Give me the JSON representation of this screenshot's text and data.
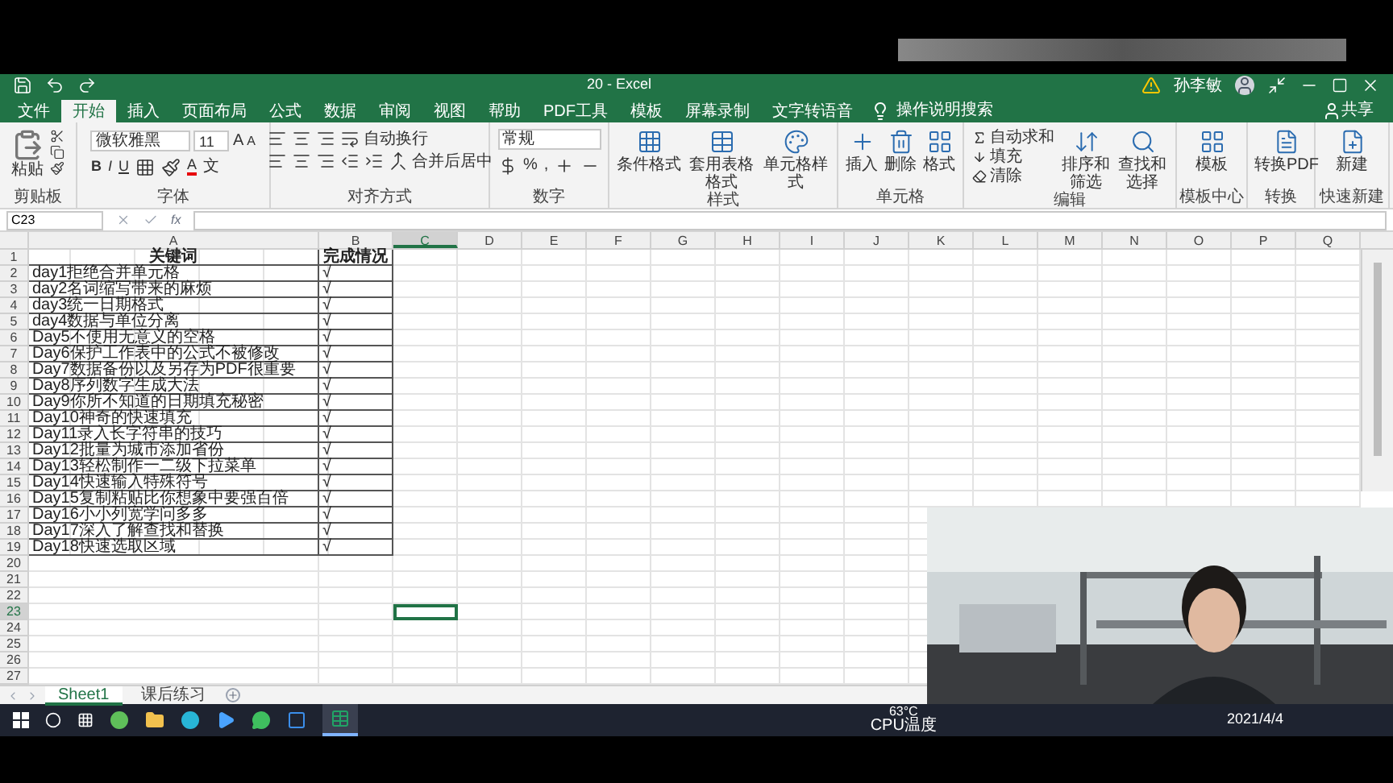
{
  "title_bar": {
    "title": "20 - Excel",
    "user": "孙李敏"
  },
  "tabs": [
    {
      "label": "文件",
      "selected": false
    },
    {
      "label": "开始",
      "selected": true
    },
    {
      "label": "插入",
      "selected": false
    },
    {
      "label": "页面布局",
      "selected": false
    },
    {
      "label": "公式",
      "selected": false
    },
    {
      "label": "数据",
      "selected": false
    },
    {
      "label": "审阅",
      "selected": false
    },
    {
      "label": "视图",
      "selected": false
    },
    {
      "label": "帮助",
      "selected": false
    },
    {
      "label": "PDF工具",
      "selected": false
    },
    {
      "label": "模板",
      "selected": false
    },
    {
      "label": "屏幕录制",
      "selected": false
    },
    {
      "label": "文字转语音",
      "selected": false
    }
  ],
  "tell_me": "操作说明搜索",
  "share": "共享",
  "ribbon": {
    "clipboard": {
      "paste": "粘贴",
      "label": "剪贴板"
    },
    "font": {
      "name": "微软雅黑",
      "size": "11",
      "grow": "A",
      "shrink": "A",
      "bold": "B",
      "italic": "I",
      "underline": "U",
      "font_color_letter": "A",
      "phonetic": "文",
      "label": "字体"
    },
    "alignment": {
      "wrap": "自动换行",
      "merge": "合并后居中",
      "label": "对齐方式"
    },
    "number": {
      "format": "常规",
      "percent": "%",
      "comma": ",",
      "label": "数字"
    },
    "styles": {
      "buttons": [
        "条件格式",
        "套用表格格式",
        "单元格样式"
      ],
      "label": "样式"
    },
    "cells": {
      "buttons": [
        "插入",
        "删除",
        "格式"
      ],
      "label": "单元格"
    },
    "editing": {
      "small": [
        "自动求和",
        "填充",
        "清除"
      ],
      "buttons": [
        "排序和筛选",
        "查找和选择"
      ],
      "label": "编辑"
    },
    "template": {
      "buttons": [
        "模板"
      ],
      "label": "模板中心"
    },
    "convert": {
      "buttons": [
        "转换PDF"
      ],
      "label": "转换"
    },
    "quick_new": {
      "buttons": [
        "新建"
      ],
      "label": "快速新建"
    }
  },
  "formula_bar": {
    "name_box": "C23",
    "fx": "fx"
  },
  "columns": [
    {
      "label": "A",
      "selected": false
    },
    {
      "label": "B",
      "selected": false
    },
    {
      "label": "C",
      "selected": true
    },
    {
      "label": "D",
      "selected": false
    },
    {
      "label": "E",
      "selected": false
    },
    {
      "label": "F",
      "selected": false
    },
    {
      "label": "G",
      "selected": false
    },
    {
      "label": "H",
      "selected": false
    },
    {
      "label": "I",
      "selected": false
    },
    {
      "label": "J",
      "selected": false
    },
    {
      "label": "K",
      "selected": false
    },
    {
      "label": "L",
      "selected": false
    },
    {
      "label": "M",
      "selected": false
    },
    {
      "label": "N",
      "selected": false
    },
    {
      "label": "O",
      "selected": false
    },
    {
      "label": "P",
      "selected": false
    },
    {
      "label": "Q",
      "selected": false
    }
  ],
  "rows": [
    {
      "number": "1",
      "selected": false,
      "cells": [
        "关键词",
        "完成情况"
      ]
    },
    {
      "number": "2",
      "selected": false,
      "cells": [
        "day1拒绝合并单元格",
        "√"
      ]
    },
    {
      "number": "3",
      "selected": false,
      "cells": [
        "day2名词缩写带来的麻烦",
        "√"
      ]
    },
    {
      "number": "4",
      "selected": false,
      "cells": [
        "day3统一日期格式",
        "√"
      ]
    },
    {
      "number": "5",
      "selected": false,
      "cells": [
        "day4数据与单位分离",
        "√"
      ]
    },
    {
      "number": "6",
      "selected": false,
      "cells": [
        "Day5不使用无意义的空格",
        "√"
      ]
    },
    {
      "number": "7",
      "selected": false,
      "cells": [
        "Day6保护工作表中的公式不被修改",
        "√"
      ]
    },
    {
      "number": "8",
      "selected": false,
      "cells": [
        "Day7数据备份以及另存为PDF很重要",
        "√"
      ]
    },
    {
      "number": "9",
      "selected": false,
      "cells": [
        "Day8序列数字生成大法",
        "√"
      ]
    },
    {
      "number": "10",
      "selected": false,
      "cells": [
        "Day9你所不知道的日期填充秘密",
        "√"
      ]
    },
    {
      "number": "11",
      "selected": false,
      "cells": [
        "Day10神奇的快速填充",
        "√"
      ]
    },
    {
      "number": "12",
      "selected": false,
      "cells": [
        "Day11录入长字符串的技巧",
        "√"
      ]
    },
    {
      "number": "13",
      "selected": false,
      "cells": [
        "Day12批量为城市添加省份",
        "√"
      ]
    },
    {
      "number": "14",
      "selected": false,
      "cells": [
        "Day13轻松制作一二级下拉菜单",
        "√"
      ]
    },
    {
      "number": "15",
      "selected": false,
      "cells": [
        "Day14快速输入特殊符号",
        "√"
      ]
    },
    {
      "number": "16",
      "selected": false,
      "cells": [
        "Day15复制粘贴比你想象中要强百倍",
        "√"
      ]
    },
    {
      "number": "17",
      "selected": false,
      "cells": [
        "Day16小小列宽学问多多",
        "√"
      ]
    },
    {
      "number": "18",
      "selected": false,
      "cells": [
        "Day17深入了解查找和替换",
        "√"
      ]
    },
    {
      "number": "19",
      "selected": false,
      "cells": [
        "Day18快速选取区域",
        "√"
      ]
    },
    {
      "number": "20",
      "selected": false,
      "cells": []
    },
    {
      "number": "21",
      "selected": false,
      "cells": []
    },
    {
      "number": "22",
      "selected": false,
      "cells": []
    },
    {
      "number": "23",
      "selected": true,
      "cells": []
    },
    {
      "number": "24",
      "selected": false,
      "cells": []
    },
    {
      "number": "25",
      "selected": false,
      "cells": []
    },
    {
      "number": "26",
      "selected": false,
      "cells": []
    },
    {
      "number": "27",
      "selected": false,
      "cells": []
    }
  ],
  "sheet_tabs": [
    {
      "label": "Sheet1",
      "selected": true
    },
    {
      "label": "课后练习",
      "selected": false
    }
  ],
  "taskbar": {
    "temperature": "63°C",
    "sensor": "CPU温度",
    "date": "2021/4/4"
  }
}
